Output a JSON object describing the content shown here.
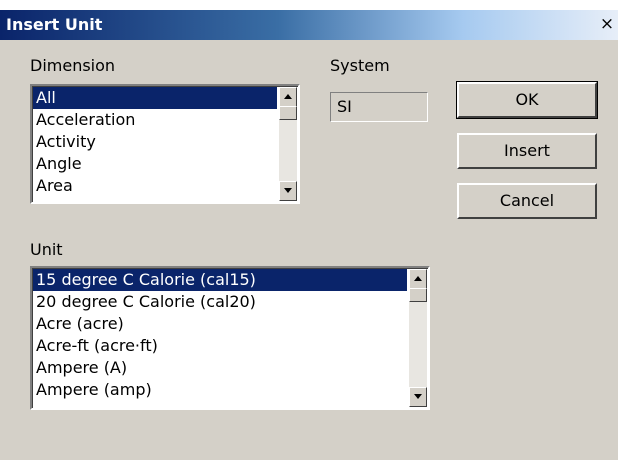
{
  "window": {
    "title": "Insert Unit",
    "close_glyph": "×"
  },
  "dimension": {
    "label": "Dimension",
    "items": [
      "All",
      "Acceleration",
      "Activity",
      "Angle",
      "Area"
    ],
    "selected_index": 0
  },
  "system": {
    "label": "System",
    "value": "SI"
  },
  "buttons": {
    "ok": "OK",
    "insert": "Insert",
    "cancel": "Cancel"
  },
  "unit": {
    "label": "Unit",
    "items": [
      "15 degree C Calorie (cal15)",
      "20 degree C Calorie (cal20)",
      "Acre (acre)",
      "Acre-ft (acre·ft)",
      "Ampere (A)",
      "Ampere (amp)"
    ],
    "selected_index": 0
  },
  "colors": {
    "selection": "#0a246a",
    "face": "#d4d0c8",
    "title_start": "#0a246a"
  }
}
